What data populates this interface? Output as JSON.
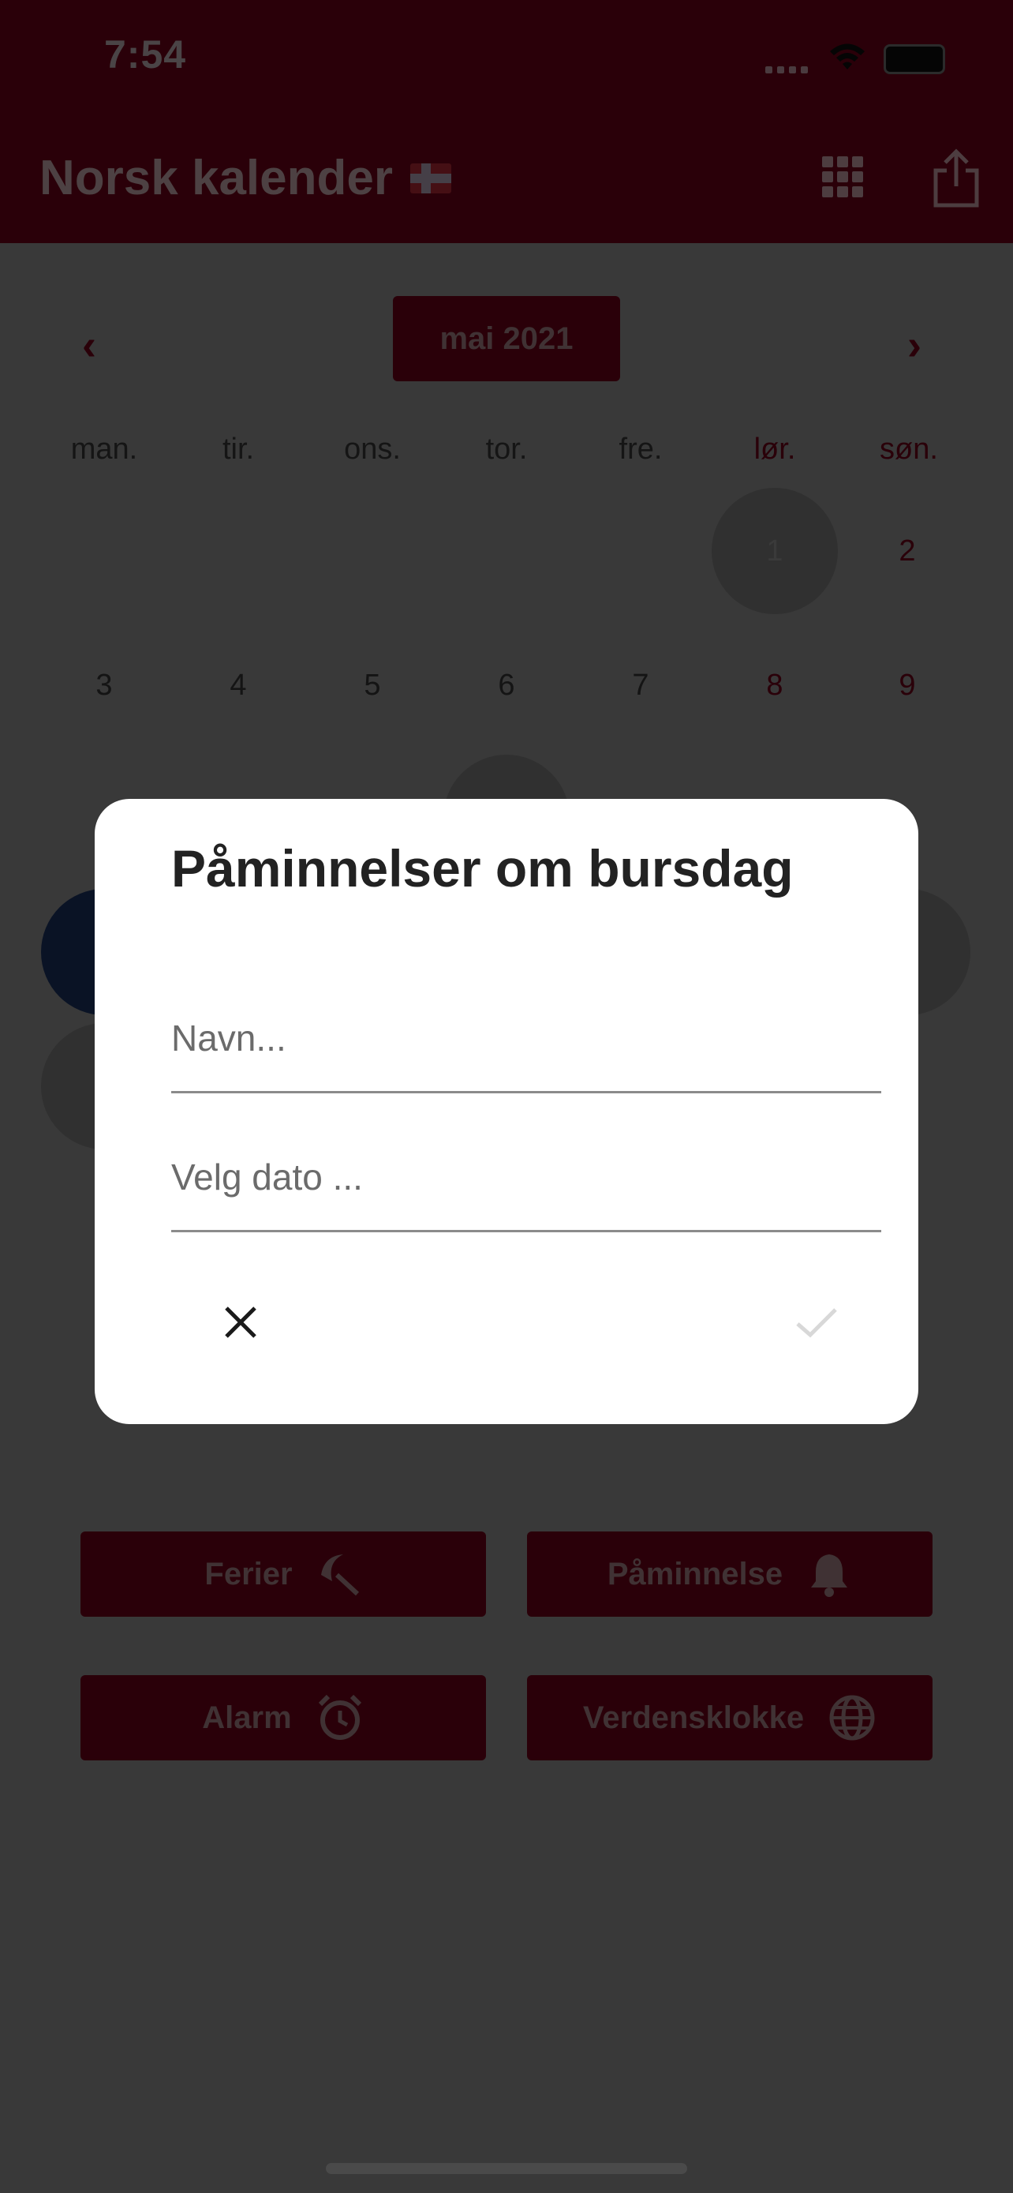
{
  "status": {
    "time": "7:54"
  },
  "header": {
    "title": "Norsk kalender"
  },
  "calendar": {
    "month": "mai 2021",
    "weekdays": [
      "man.",
      "tir.",
      "ons.",
      "tor.",
      "fre.",
      "lør.",
      "søn."
    ],
    "days": [
      "1",
      "2",
      "3",
      "4",
      "5",
      "6",
      "7",
      "8",
      "9"
    ]
  },
  "actions": {
    "ferier": "Ferier",
    "paminnelse": "Påminnelse",
    "alarm": "Alarm",
    "verdensklokke": "Verdensklokke"
  },
  "dialog": {
    "title": "Påminnelser om bursdag",
    "name_placeholder": "Navn...",
    "date_placeholder": "Velg dato ..."
  },
  "colors": {
    "brand": "#2a0009",
    "overlay": "#393939",
    "dialog_bg": "#ffffff"
  },
  "icons": [
    "flag-icon",
    "grid-icon",
    "share-icon",
    "umbrella-icon",
    "bell-icon",
    "alarm-clock-icon",
    "globe-icon",
    "close-icon",
    "check-icon"
  ]
}
